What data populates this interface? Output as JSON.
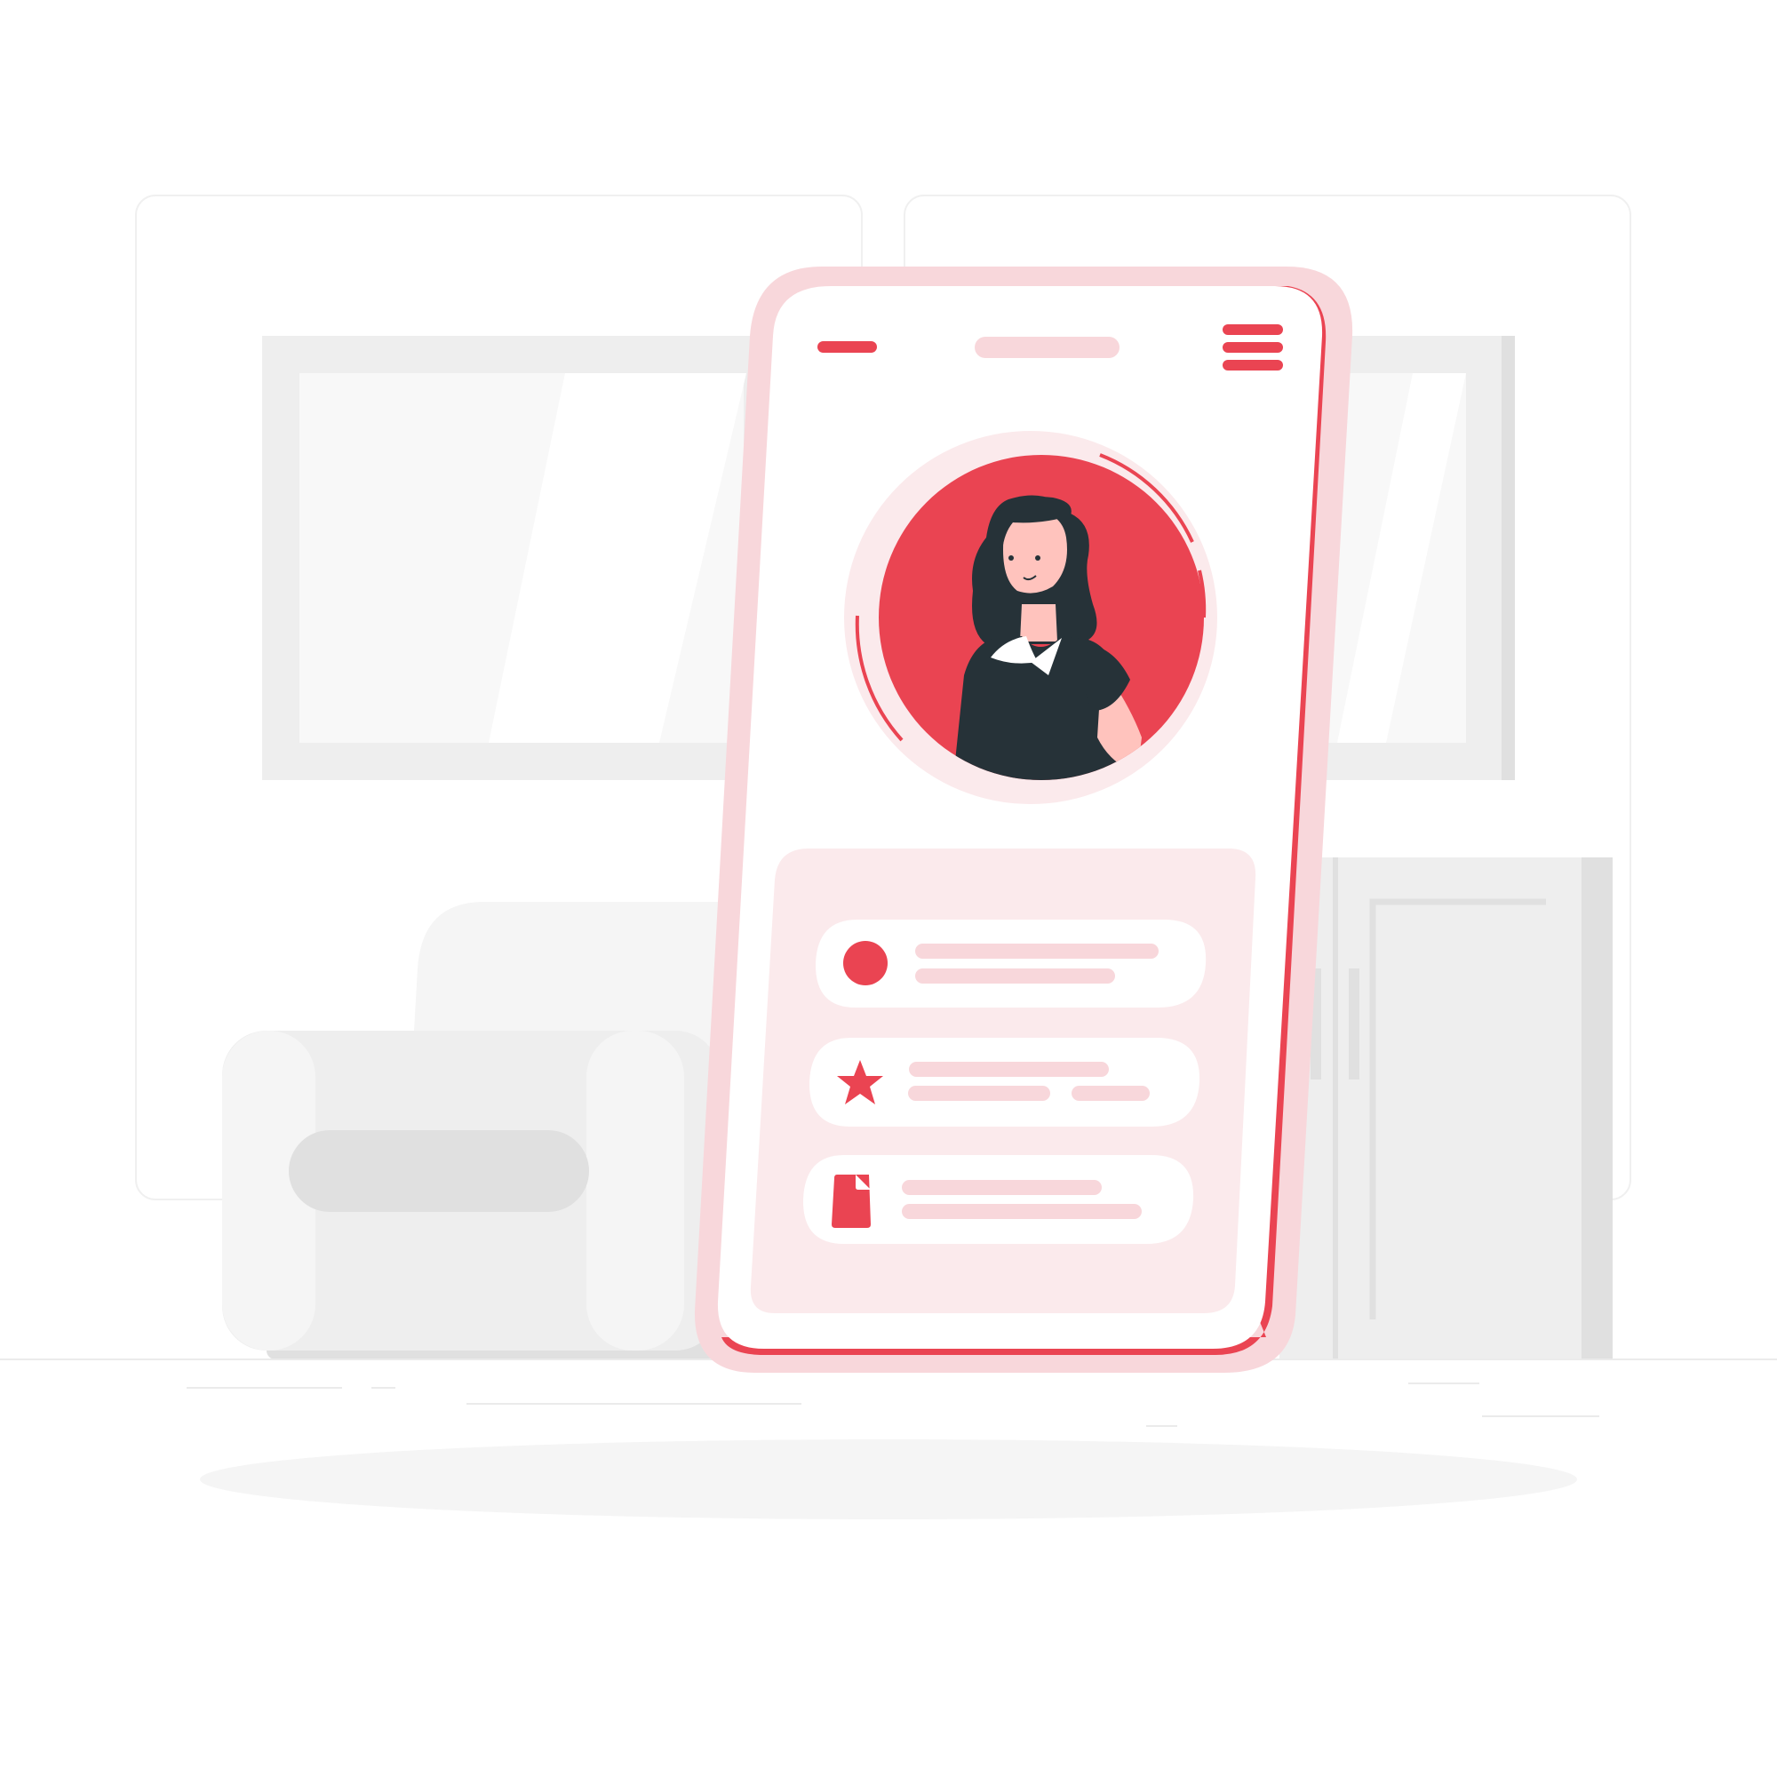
{
  "colors": {
    "accent": "#EA4452",
    "accent_light": "#F8D7DB",
    "accent_pale": "#FBEAEC",
    "skin": "#FFC3BD",
    "hair": "#263238",
    "bg_gray": "#EEEEEE",
    "bg_light": "#F5F5F5",
    "bg_mid": "#E0E0E0"
  },
  "icons": {
    "menu": "hamburger-menu-icon",
    "back": "minus-bar-icon",
    "item1": "red-dot-icon",
    "item2": "star-icon",
    "item3": "document-icon"
  },
  "profile": {
    "avatar": "woman-avatar-illustration"
  },
  "list_items": [
    {
      "icon": "red-dot-icon"
    },
    {
      "icon": "star-icon"
    },
    {
      "icon": "document-icon"
    }
  ]
}
